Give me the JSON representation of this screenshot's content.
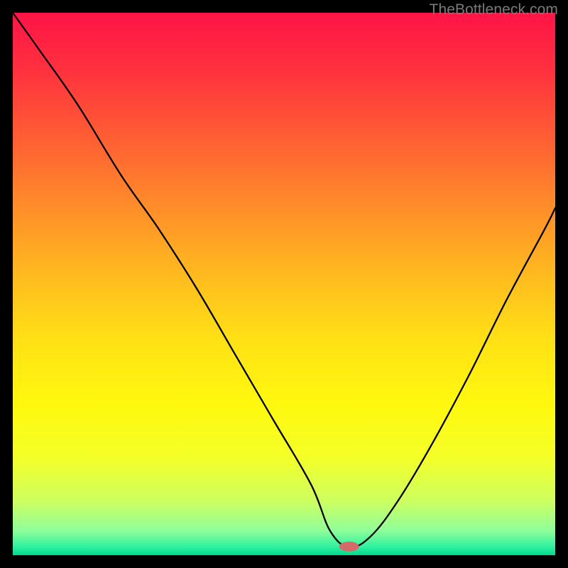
{
  "watermark": "TheBottleneck.com",
  "gradient": {
    "stops": [
      {
        "offset": 0.0,
        "color": "#ff1446"
      },
      {
        "offset": 0.1,
        "color": "#ff2f3f"
      },
      {
        "offset": 0.22,
        "color": "#ff5a34"
      },
      {
        "offset": 0.35,
        "color": "#ff8a2a"
      },
      {
        "offset": 0.48,
        "color": "#ffb91f"
      },
      {
        "offset": 0.6,
        "color": "#ffe016"
      },
      {
        "offset": 0.72,
        "color": "#fff80e"
      },
      {
        "offset": 0.82,
        "color": "#f4ff28"
      },
      {
        "offset": 0.9,
        "color": "#cdff60"
      },
      {
        "offset": 0.955,
        "color": "#8fff9a"
      },
      {
        "offset": 0.985,
        "color": "#2df0a0"
      },
      {
        "offset": 1.0,
        "color": "#00d98b"
      }
    ]
  },
  "marker": {
    "x_norm": 0.62,
    "y_norm": 0.984,
    "rx": 14,
    "ry": 7,
    "fill": "#d46a6a"
  },
  "chart_data": {
    "type": "line",
    "title": "",
    "xlabel": "",
    "ylabel": "",
    "xlim": [
      0,
      1
    ],
    "ylim": [
      0,
      1
    ],
    "x": [
      0.0,
      0.05,
      0.12,
      0.2,
      0.27,
      0.34,
      0.41,
      0.48,
      0.55,
      0.585,
      0.62,
      0.66,
      0.71,
      0.77,
      0.84,
      0.91,
      0.98,
      1.0
    ],
    "y_from_top": [
      0.0,
      0.07,
      0.17,
      0.3,
      0.4,
      0.51,
      0.63,
      0.75,
      0.87,
      0.955,
      0.985,
      0.965,
      0.9,
      0.8,
      0.67,
      0.53,
      0.4,
      0.36
    ],
    "marker_point": {
      "x": 0.62,
      "y_from_top": 0.984
    },
    "note": "y_from_top is normalized distance from the top edge (0 = top, 1 = bottom). Values estimated visually."
  }
}
